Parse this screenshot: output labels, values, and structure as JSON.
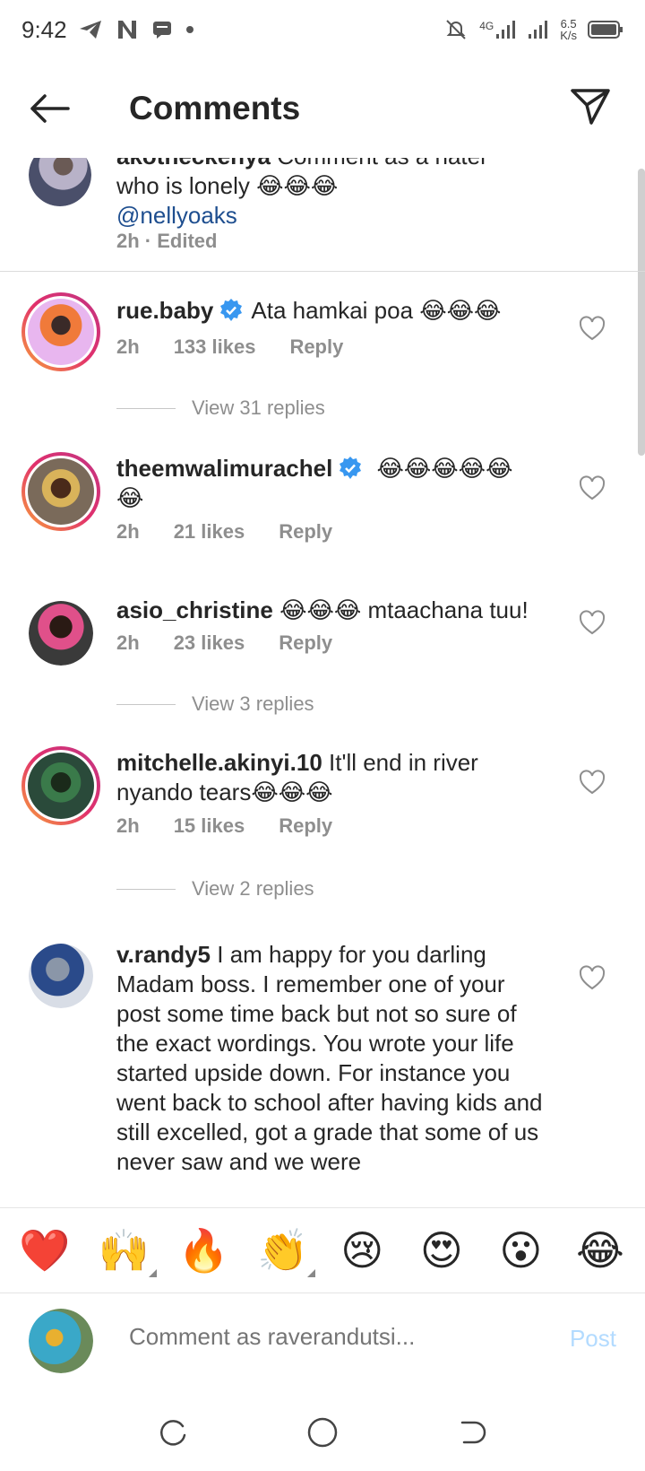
{
  "status_bar": {
    "time": "9:42",
    "network": "4G",
    "speed_value": "6.5",
    "speed_unit": "K/s"
  },
  "header": {
    "title": "Comments"
  },
  "comments": [
    {
      "user_partial": "akotheckenya",
      "text_partial": "Comment as a hater",
      "text_line": "who is lonely 😂😂😂",
      "mention": "@nellyoaks",
      "meta": "2h · Edited"
    },
    {
      "user": "rue.baby",
      "text": "Ata hamkai poa 😂😂😂",
      "time": "2h",
      "likes": "133 likes",
      "reply": "Reply",
      "view_replies": "View 31 replies"
    },
    {
      "user": "theemwalimurachel",
      "text": "😂😂😂😂😂 😂",
      "time": "2h",
      "likes": "21 likes",
      "reply": "Reply"
    },
    {
      "user": "asio_christine",
      "text": "😂😂😂 mtaachana tuu!",
      "time": "2h",
      "likes": "23 likes",
      "reply": "Reply",
      "view_replies": "View 3 replies"
    },
    {
      "user": "mitchelle.akinyi.10",
      "text": "It'll end in river nyando tears😂😂😂",
      "time": "2h",
      "likes": "15 likes",
      "reply": "Reply",
      "view_replies": "View 2 replies"
    },
    {
      "user": "v.randy5",
      "text": "I am happy for you darling Madam boss. I remember one of your post some time back but not so sure of the exact wordings. You wrote your life started upside down. For instance you went back to school after having kids and still excelled, got a grade that some of us never saw and we were"
    }
  ],
  "emoji_bar": [
    "❤️",
    "🙌",
    "🔥",
    "👏",
    "😢",
    "😍",
    "😮",
    "😂"
  ],
  "compose": {
    "placeholder": "Comment as raverandutsi...",
    "post_label": "Post"
  },
  "colors": {
    "link": "#1e4e8f",
    "verified": "#3897f0",
    "muted": "#8e8e8e",
    "post_disabled": "#b3dbff"
  }
}
